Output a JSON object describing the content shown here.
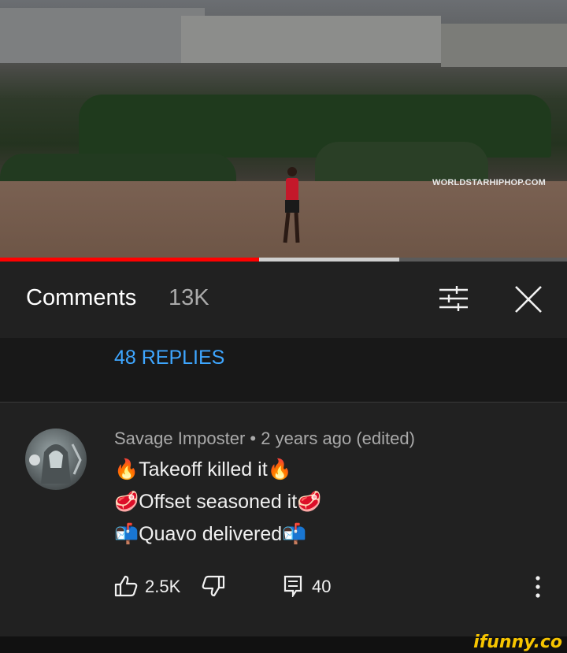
{
  "video": {
    "watermark": "WORLDSTARHIPHOP.COM",
    "progress_played": 0.457,
    "progress_buffered": 0.704
  },
  "header": {
    "title": "Comments",
    "count": "13K"
  },
  "thread": {
    "replies_label": "48 REPLIES"
  },
  "comment": {
    "author": "Savage Imposter",
    "meta": "Savage Imposter • 2 years ago (edited)",
    "lines": [
      "🔥Takeoff killed it🔥",
      "🥩Offset seasoned it🥩",
      "📬Quavo delivered📬"
    ],
    "likes": "2.5K",
    "reply_count": "40"
  },
  "footer": {
    "brand": "ifunny.co"
  }
}
